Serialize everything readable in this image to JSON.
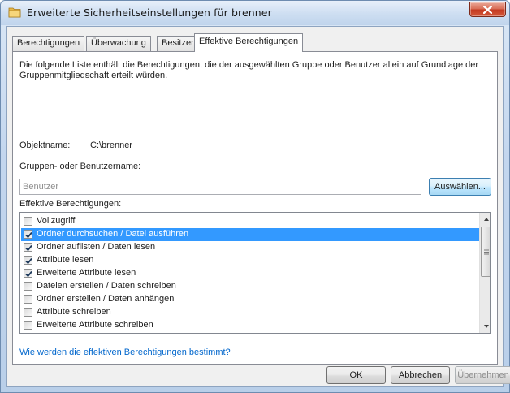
{
  "window": {
    "title": "Erweiterte Sicherheitseinstellungen für brenner"
  },
  "tabs": [
    {
      "label": "Berechtigungen"
    },
    {
      "label": "Überwachung"
    },
    {
      "label": "Besitzer"
    },
    {
      "label": "Effektive Berechtigungen"
    }
  ],
  "active_tab": "Effektive Berechtigungen",
  "panel": {
    "description": "Die folgende Liste enthält die Berechtigungen, die der ausgewählten Gruppe oder Benutzer allein auf Grundlage der Gruppenmitgliedschaft erteilt würden.",
    "object_label": "Objektname:",
    "object_value": "C:\\brenner",
    "group_label": "Gruppen- oder Benutzername:",
    "group_input_value": "Benutzer",
    "select_button": "Auswählen...",
    "effective_label": "Effektive Berechtigungen:",
    "permissions": [
      {
        "label": "Vollzugriff",
        "checked": false,
        "selected": false
      },
      {
        "label": "Ordner durchsuchen / Datei ausführen",
        "checked": true,
        "selected": true
      },
      {
        "label": "Ordner auflisten / Daten lesen",
        "checked": true,
        "selected": false
      },
      {
        "label": "Attribute lesen",
        "checked": true,
        "selected": false
      },
      {
        "label": "Erweiterte Attribute lesen",
        "checked": true,
        "selected": false
      },
      {
        "label": "Dateien erstellen / Daten schreiben",
        "checked": false,
        "selected": false
      },
      {
        "label": "Ordner erstellen / Daten anhängen",
        "checked": false,
        "selected": false
      },
      {
        "label": "Attribute schreiben",
        "checked": false,
        "selected": false
      },
      {
        "label": "Erweiterte Attribute schreiben",
        "checked": false,
        "selected": false
      }
    ],
    "help_link": "Wie werden die effektiven Berechtigungen bestimmt?"
  },
  "buttons": {
    "ok": "OK",
    "cancel": "Abbrechen",
    "apply": "Übernehmen"
  },
  "colors": {
    "selection": "#3399ff",
    "link": "#0066cc",
    "close_button": "#c4391f"
  }
}
